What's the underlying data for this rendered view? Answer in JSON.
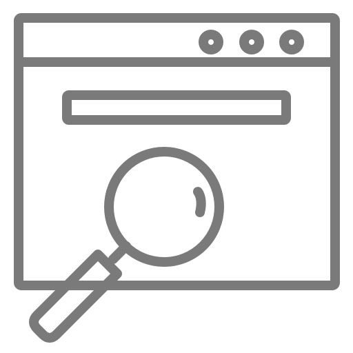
{
  "icon": {
    "name": "browser-window-search-icon",
    "color": "#7a7a7a",
    "background": "#ffffff",
    "parts": {
      "window": "browser-window-icon",
      "dots": [
        "window-dot-icon",
        "window-dot-icon",
        "window-dot-icon"
      ],
      "search_bar": "search-bar-icon",
      "magnifier": "magnifying-glass-icon"
    }
  }
}
